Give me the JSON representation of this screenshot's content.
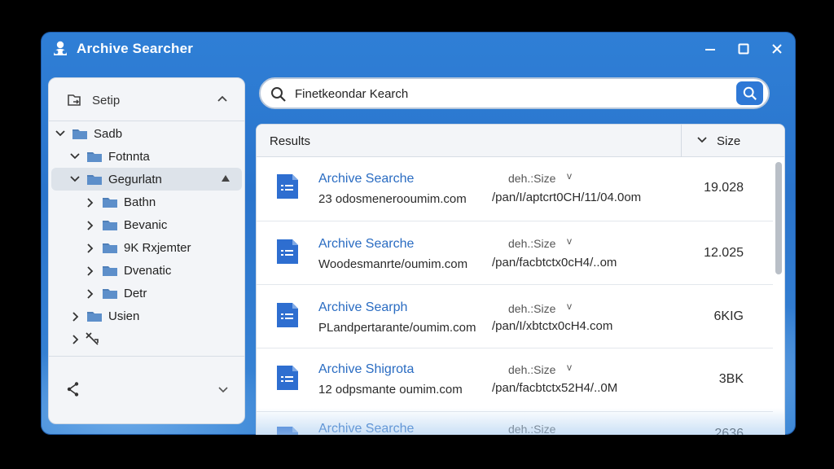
{
  "window": {
    "title": "Archive Searcher"
  },
  "sidebar": {
    "header_label": "Setip",
    "tree": [
      {
        "label": "Sadb",
        "expanded": true
      },
      {
        "label": "Fotnnta",
        "expanded": true
      },
      {
        "label": "Gegurlatn",
        "expanded": true,
        "selected": true
      },
      {
        "label": "Bathn",
        "expanded": false
      },
      {
        "label": "Bevanic",
        "expanded": false
      },
      {
        "label": "9K Rxjemter",
        "expanded": false
      },
      {
        "label": "Dvenatic",
        "expanded": false
      },
      {
        "label": "Detr",
        "expanded": false
      },
      {
        "label": "Usien",
        "expanded": false
      }
    ]
  },
  "search": {
    "value": "Finetkeondar Kearch"
  },
  "results": {
    "header_title": "Results",
    "size_header": "Size",
    "items": [
      {
        "name": "Archive Searche",
        "sub": "23 odosmenerooumim.com",
        "meta": "deh.:Size",
        "path": "/pan/I/aptcrt0CH/11/04.0om",
        "size": "19.028"
      },
      {
        "name": "Archive Searche",
        "sub": "Woodesmanrte/oumim.com",
        "meta": "deh.:Size",
        "path": "/pan/facbtctx0cH4/..om",
        "size": "12.025"
      },
      {
        "name": "Archive Searph",
        "sub": "PLandpertarante/oumim.com",
        "meta": "deh.:Size",
        "path": "/pan/I/xbtctx0cH4.com",
        "size": "6KIG"
      },
      {
        "name": "Archive Shigrota",
        "sub": "12 odpsmante oumim.com",
        "meta": "deh.:Size",
        "path": "/pan/facbtctx52H4/..0M",
        "size": "3BK"
      },
      {
        "name": "Archive Searche",
        "sub": "",
        "meta": "deh.:Size",
        "path": "",
        "size": "2636"
      }
    ]
  },
  "colors": {
    "accent": "#2e78d6",
    "link": "#2a6cc2",
    "window_bg": "#2f7fd6"
  }
}
